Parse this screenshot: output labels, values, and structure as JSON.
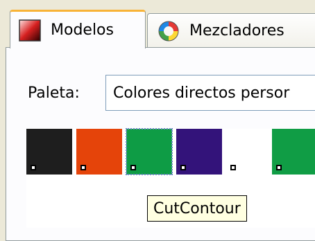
{
  "tabs": [
    {
      "label": "Modelos",
      "icon": "color-model-icon",
      "active": true
    },
    {
      "label": "Mezcladores",
      "icon": "color-wheel-icon",
      "active": false
    }
  ],
  "palette": {
    "label": "Paleta:",
    "selected": "Colores directos persor"
  },
  "swatches": [
    {
      "color": "#1e1e1e",
      "selected": false
    },
    {
      "color": "#e5440a",
      "selected": false
    },
    {
      "color": "#0e9c45",
      "selected": true
    },
    {
      "color": "#33137a",
      "selected": false
    },
    {
      "color": "#ffffff",
      "selected": false
    },
    {
      "color": "#109d45",
      "selected": false
    }
  ],
  "tooltip": {
    "text": "CutContour"
  }
}
